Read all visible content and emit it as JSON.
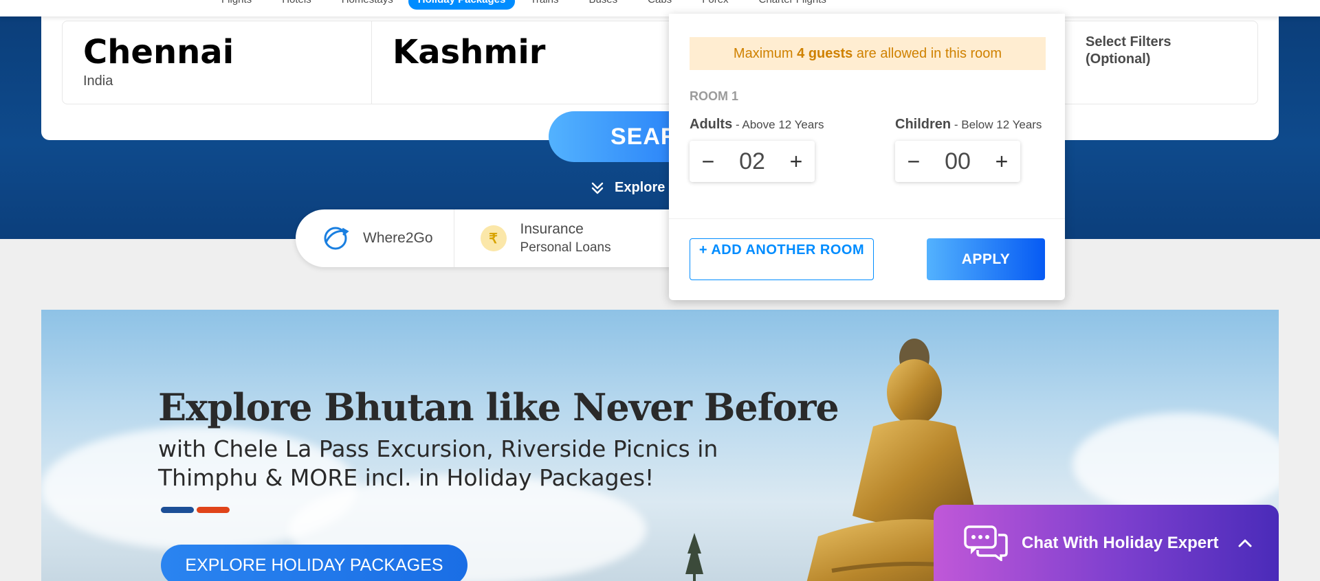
{
  "nav": {
    "tabs": [
      "Flights",
      "Hotels",
      "Homestays",
      "Holiday Packages",
      "Trains",
      "Buses",
      "Cabs",
      "Forex",
      "Charter Flights"
    ],
    "active_tab": "Holiday Packages"
  },
  "search": {
    "from_city": "Chennai",
    "from_country": "India",
    "to_city": "Kashmir",
    "filters_label": "Select Filters (Optional)",
    "search_button": "SEARCH",
    "explore_more": "Explore More"
  },
  "quick_links": [
    {
      "title": "Where2Go",
      "subtitle": ""
    },
    {
      "title": "Insurance",
      "subtitle": "Personal Loans"
    }
  ],
  "room_popup": {
    "notice_prefix": "Maximum ",
    "notice_bold": "4 guests",
    "notice_suffix": " are allowed in this room",
    "room_label": "ROOM 1",
    "adults_label": "Adults",
    "adults_hint": " - Above 12 Years",
    "adults_value": "02",
    "children_label": "Children",
    "children_hint": " - Below 12 Years",
    "children_value": "00",
    "minus": "−",
    "plus": "+",
    "add_room": "+ ADD ANOTHER ROOM",
    "apply": "APPLY"
  },
  "banner": {
    "title": "Explore Bhutan like Never Before",
    "subtitle": "with Chele La Pass Excursion, Riverside Picnics in Thimphu & MORE incl. in Holiday Packages!",
    "cta": "EXPLORE HOLIDAY PACKAGES"
  },
  "chat": {
    "label": "Chat With Holiday Expert"
  },
  "colors": {
    "hero_blue": "#0e4a8c",
    "brand_blue": "#008cff",
    "notice_bg": "#ffedd1",
    "notice_text": "#cf8100",
    "chat_purple": "#7c3fce"
  }
}
